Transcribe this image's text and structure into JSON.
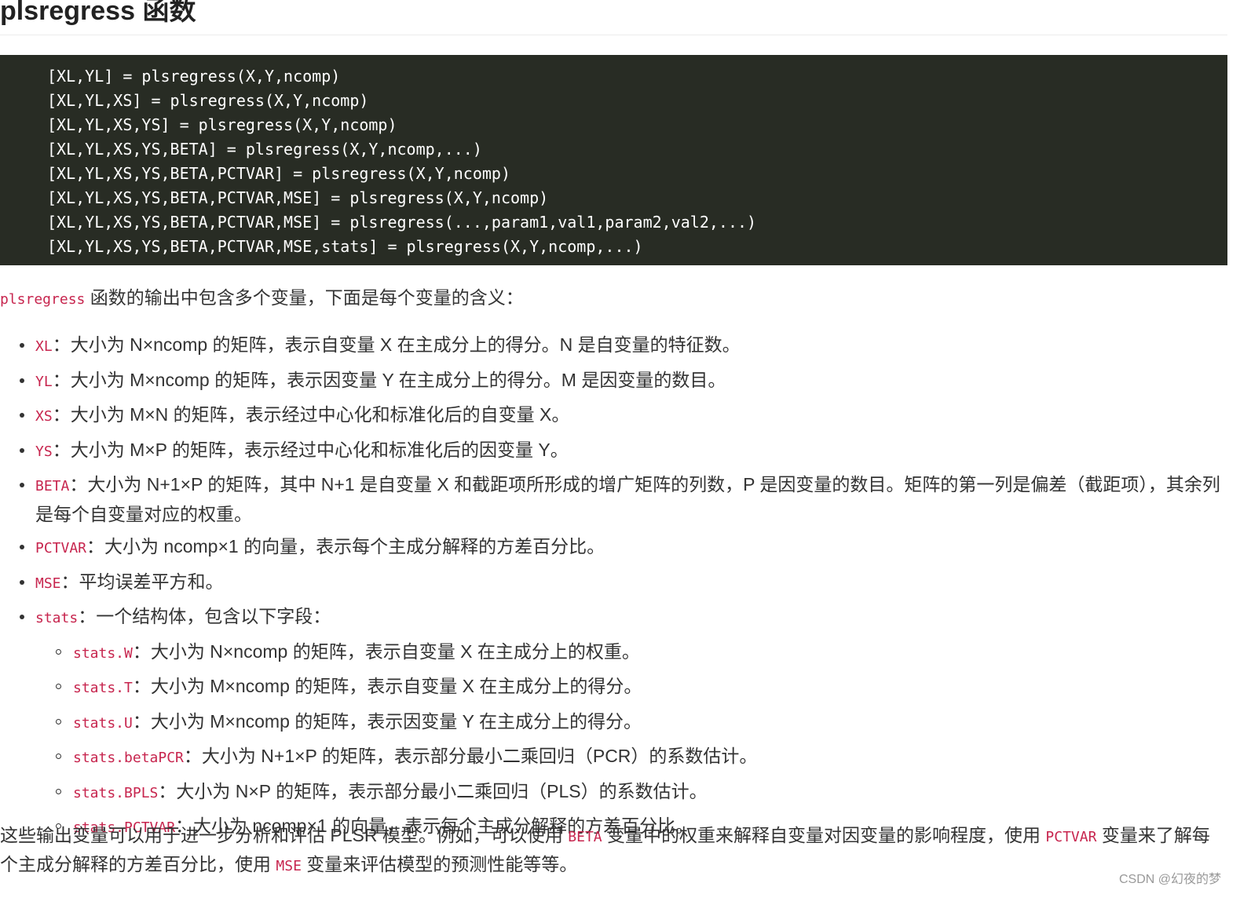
{
  "title": "plsregress 函数",
  "code_lines": [
    "[XL,YL] = plsregress(X,Y,ncomp)",
    "[XL,YL,XS] = plsregress(X,Y,ncomp)",
    "[XL,YL,XS,YS] = plsregress(X,Y,ncomp)",
    "[XL,YL,XS,YS,BETA] = plsregress(X,Y,ncomp,...)",
    "[XL,YL,XS,YS,BETA,PCTVAR] = plsregress(X,Y,ncomp)",
    "[XL,YL,XS,YS,BETA,PCTVAR,MSE] = plsregress(X,Y,ncomp)",
    "[XL,YL,XS,YS,BETA,PCTVAR,MSE] = plsregress(...,param1,val1,param2,val2,...)",
    "[XL,YL,XS,YS,BETA,PCTVAR,MSE,stats] = plsregress(X,Y,ncomp,...)"
  ],
  "intro": {
    "code": "plsregress",
    "text": " 函数的输出中包含多个变量，下面是每个变量的含义："
  },
  "outputs": [
    {
      "name": "XL",
      "desc": "：大小为 N×ncomp 的矩阵，表示自变量 X 在主成分上的得分。N 是自变量的特征数。"
    },
    {
      "name": "YL",
      "desc": "：大小为 M×ncomp 的矩阵，表示因变量 Y 在主成分上的得分。M 是因变量的数目。"
    },
    {
      "name": "XS",
      "desc": "：大小为 M×N 的矩阵，表示经过中心化和标准化后的自变量 X。"
    },
    {
      "name": "YS",
      "desc": "：大小为 M×P 的矩阵，表示经过中心化和标准化后的因变量 Y。"
    },
    {
      "name": "BETA",
      "desc": "：大小为 N+1×P 的矩阵，其中 N+1 是自变量 X 和截距项所形成的增广矩阵的列数，P 是因变量的数目。矩阵的第一列是偏差（截距项），其余列是每个自变量对应的权重。"
    },
    {
      "name": "PCTVAR",
      "desc": "：大小为 ncomp×1 的向量，表示每个主成分解释的方差百分比。"
    },
    {
      "name": "MSE",
      "desc": "：平均误差平方和。"
    },
    {
      "name": "stats",
      "desc": "：一个结构体，包含以下字段："
    }
  ],
  "stats_fields": [
    {
      "name": "stats.W",
      "desc": "：大小为 N×ncomp 的矩阵，表示自变量 X 在主成分上的权重。"
    },
    {
      "name": "stats.T",
      "desc": "：大小为 M×ncomp 的矩阵，表示自变量 X 在主成分上的得分。"
    },
    {
      "name": "stats.U",
      "desc": "：大小为 M×ncomp 的矩阵，表示因变量 Y 在主成分上的得分。"
    },
    {
      "name": "stats.betaPCR",
      "desc": "：大小为 N+1×P 的矩阵，表示部分最小二乘回归（PCR）的系数估计。"
    },
    {
      "name": "stats.BPLS",
      "desc": "：大小为 N×P 的矩阵，表示部分最小二乘回归（PLS）的系数估计。"
    },
    {
      "name": "stats.PCTVAR",
      "desc": "：大小为 ncomp×1 的向量，表示每个主成分解释的方差百分比。"
    }
  ],
  "summary": {
    "text1": "这些输出变量可以用于进一步分析和评估 PLSR 模型。例如，可以使用 ",
    "code1": "BETA",
    "text2": " 变量中的权重来解释自变量对因变量的影响程度，使用 ",
    "code2": "PCTVAR",
    "text3": " 变量来了解每个主成分解释的方差百分比，使用 ",
    "code3": "MSE",
    "text4": " 变量来评估模型的预测性能等等。"
  },
  "watermark": "CSDN @幻夜的梦"
}
